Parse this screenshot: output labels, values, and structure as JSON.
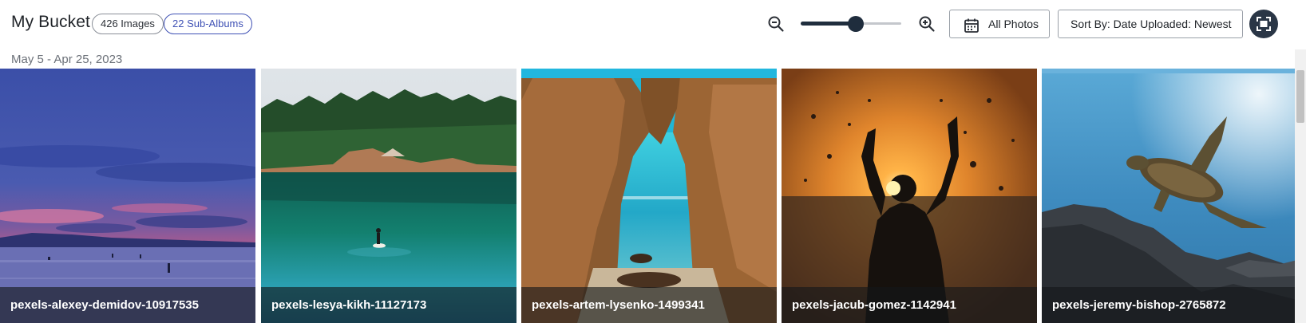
{
  "header": {
    "title": "My Bucket",
    "images_badge": "426 Images",
    "subalbums_badge": "22 Sub-Albums",
    "zoom_level": 0.55,
    "all_photos_label": "All Photos",
    "sort_label": "Sort By: Date Uploaded: Newest"
  },
  "gallery": {
    "date_range": "May 5 - Apr 25, 2023",
    "photos": [
      {
        "caption": "pexels-alexey-demidov-10917535"
      },
      {
        "caption": "pexels-lesya-kikh-11127173"
      },
      {
        "caption": "pexels-artem-lysenko-1499341"
      },
      {
        "caption": "pexels-jacub-gomez-1142941"
      },
      {
        "caption": "pexels-jeremy-bishop-2765872"
      }
    ]
  },
  "icons": {
    "zoom_out": "zoom-out-icon",
    "zoom_in": "zoom-in-icon",
    "calendar": "calendar-icon",
    "fullscreen": "fullscreen-icon"
  },
  "colors": {
    "accent": "#3f51b5",
    "dark": "#1f2d3d"
  }
}
